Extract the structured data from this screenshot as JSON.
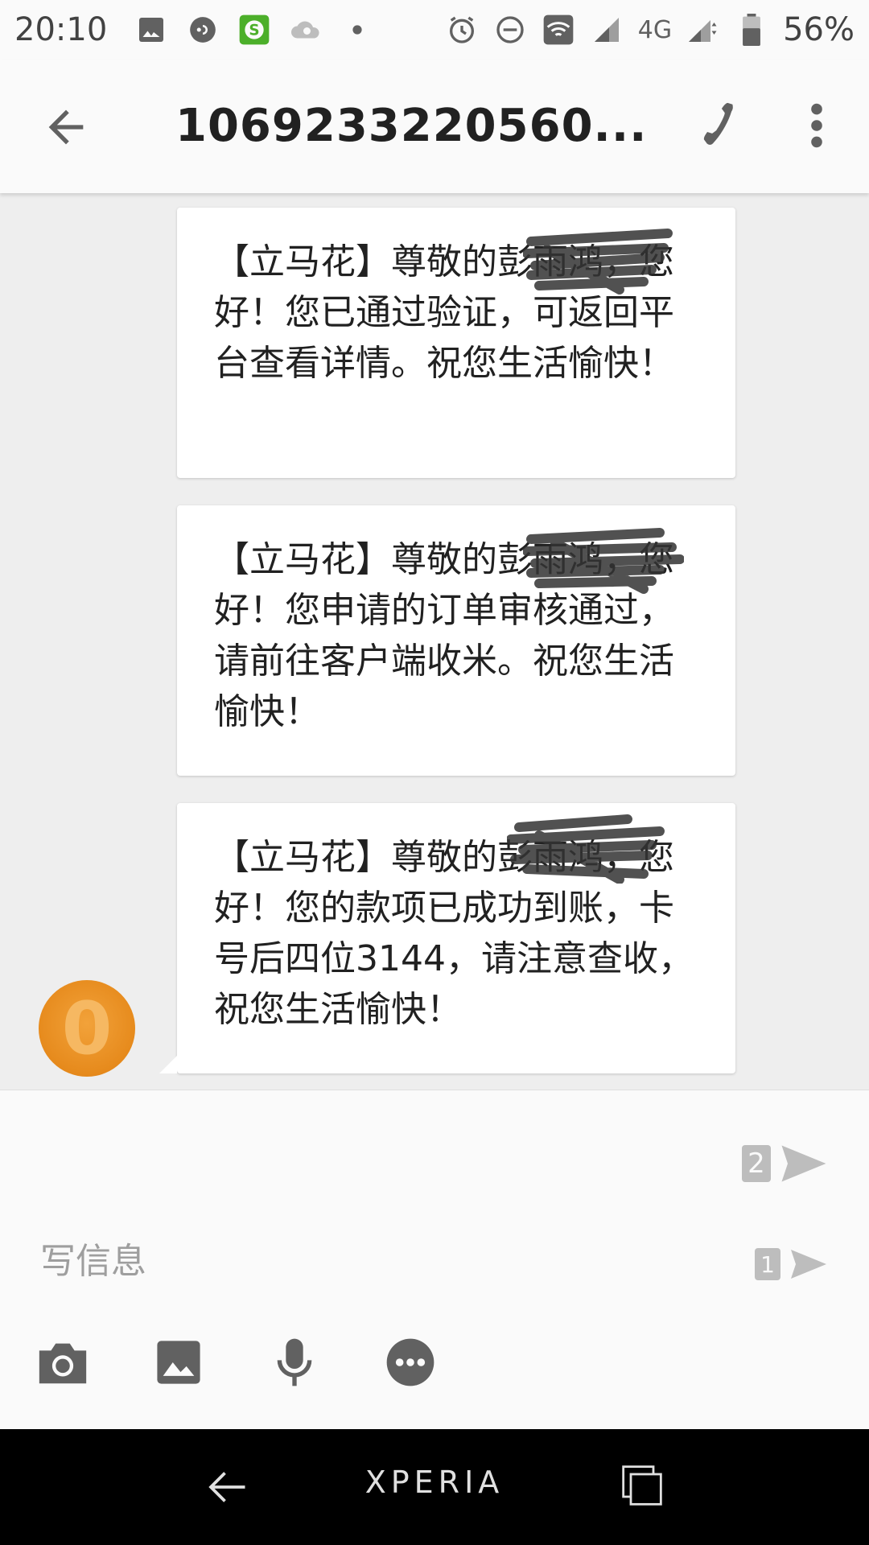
{
  "status_bar": {
    "time": "20:10",
    "network": "4G",
    "battery": "56%",
    "icons": [
      "image-icon",
      "chat-icon",
      "app-s-icon",
      "cloud-icon",
      "dot-icon",
      "alarm-icon",
      "dnd-icon",
      "wifi-icon",
      "signal-icon",
      "signal-icon-2",
      "battery-icon"
    ]
  },
  "app_bar": {
    "title": "1069233220560...",
    "back_icon": "back-arrow-icon",
    "call_icon": "phone-icon",
    "more_icon": "more-vert-icon"
  },
  "messages": [
    {
      "text": "【立马花】尊敬的彭雨鸿，您好！您已通过验证，可返回平台查看详情。祝您生活愉快！"
    },
    {
      "text": "【立马花】尊敬的彭雨鸿，您好！您申请的订单审核通过，请前往客户端收米。祝您生活愉快！"
    },
    {
      "text": "【立马花】尊敬的彭雨鸿，您好！您的款项已成功到账，卡号后四位3144，请注意查收，祝您生活愉快！"
    }
  ],
  "avatar": {
    "letter": "0",
    "color": "#e68a1c"
  },
  "compose": {
    "placeholder": "写信息",
    "sim2_label": "2",
    "sim1_label": "1",
    "attachments": [
      "camera-icon",
      "image-icon",
      "mic-icon",
      "more-horiz-icon"
    ]
  },
  "nav_bar": {
    "brand": "XPERIA"
  },
  "colors": {
    "accent": "#e68a1c",
    "background": "#eeeeee",
    "bubble": "#ffffff",
    "icon_gray": "#616161"
  }
}
